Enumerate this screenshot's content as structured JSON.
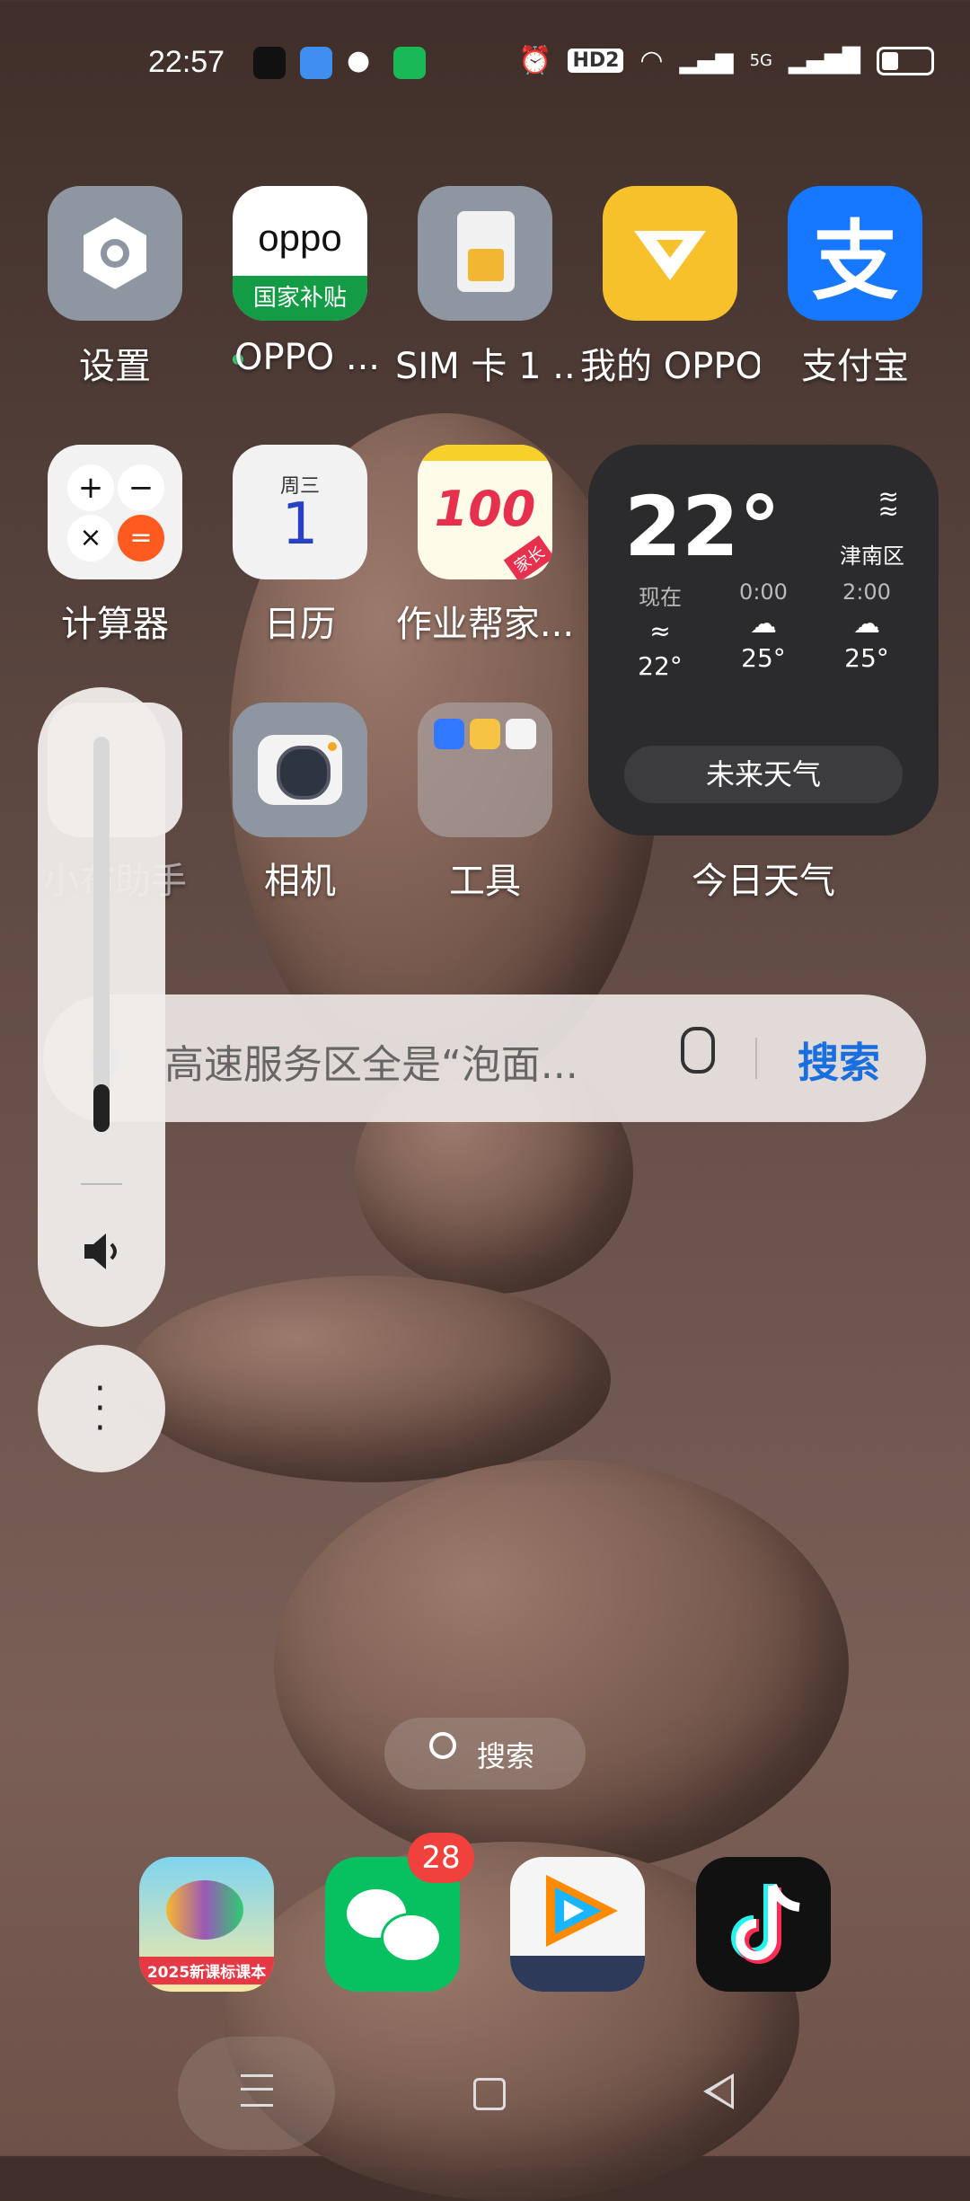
{
  "status_bar": {
    "time": "22:57",
    "hd_badge": "HD2",
    "network": "5G",
    "icons": [
      "tiktok-icon",
      "weather-icon",
      "wechat-icon",
      "iqiyi-icon",
      "alarm-icon",
      "wifi-icon",
      "signal-icon",
      "battery-icon"
    ]
  },
  "apps_row1": [
    {
      "label": "设置",
      "icon": "settings-icon"
    },
    {
      "label": "OPPO ...",
      "icon": "oppo-store-icon",
      "tile_text": "oppo",
      "tile_sub": "国家补贴"
    },
    {
      "label": "SIM 卡 1 ...",
      "icon": "sim-card-icon"
    },
    {
      "label": "我的 OPPO",
      "icon": "my-oppo-icon"
    },
    {
      "label": "支付宝",
      "icon": "alipay-icon",
      "tile_text": "支"
    }
  ],
  "apps_row2": [
    {
      "label": "计算器",
      "icon": "calculator-icon"
    },
    {
      "label": "日历",
      "icon": "calendar-icon",
      "weekday": "周三",
      "day": "1"
    },
    {
      "label": "作业帮家...",
      "icon": "zuoyebang-icon",
      "tile_text": "100",
      "tile_sub": "家长"
    }
  ],
  "apps_row3": [
    {
      "label": "小布助手",
      "icon": "assistant-icon"
    },
    {
      "label": "相机",
      "icon": "camera-icon"
    },
    {
      "label": "工具",
      "icon": "folder-icon"
    }
  ],
  "weather": {
    "temp": "22°",
    "district": "津南区",
    "forecast": [
      {
        "time": "现在",
        "temp": "22°",
        "icon": "haze-icon"
      },
      {
        "time": "0:00",
        "temp": "25°",
        "icon": "partly-cloudy-icon"
      },
      {
        "time": "2:00",
        "temp": "25°",
        "icon": "partly-cloudy-icon"
      }
    ],
    "button": "未来天气",
    "widget_label": "今日天气"
  },
  "search": {
    "placeholder": "高速服务区全是“泡面...",
    "button": "搜索"
  },
  "volume": {
    "level": 0.12
  },
  "pill_search": "搜索",
  "dock": [
    {
      "icon": "textbook-app-icon",
      "tile_text": "2025新课标课本"
    },
    {
      "icon": "wechat-icon",
      "badge": "28"
    },
    {
      "icon": "tencent-video-icon"
    },
    {
      "icon": "tiktok-icon"
    }
  ],
  "colors": {
    "accent": "#1a6fe0",
    "badge": "#f0413c",
    "weather_bg": "#2b2a2c"
  }
}
